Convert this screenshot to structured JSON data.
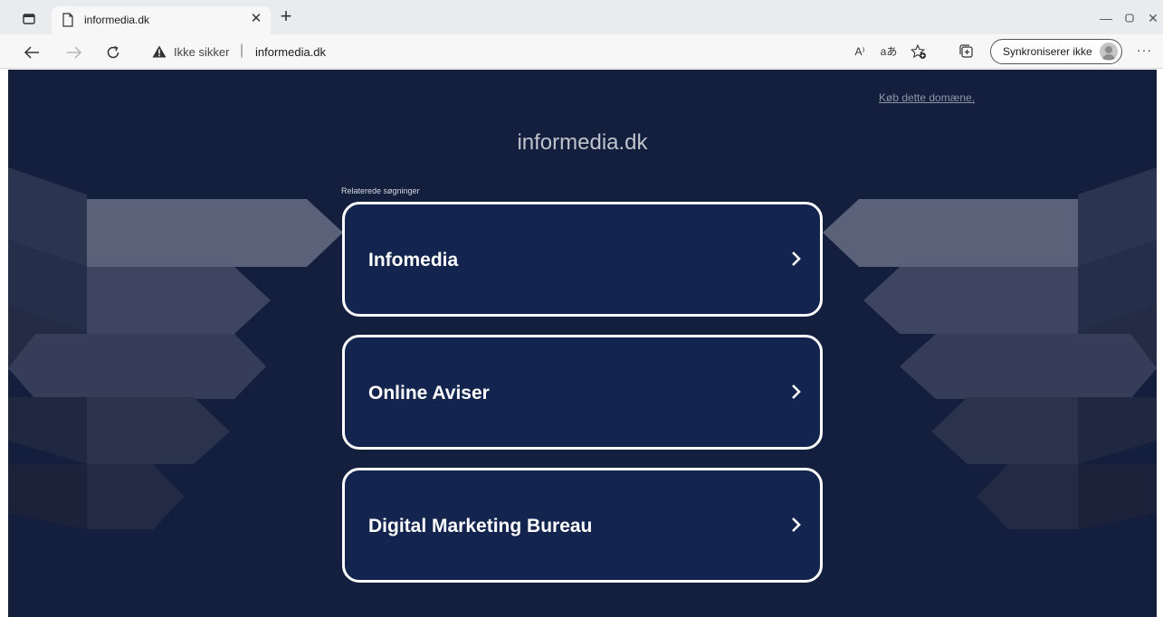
{
  "browser": {
    "tab_title": "informedia.dk",
    "security_label": "Ikke sikker",
    "url": "informedia.dk",
    "sync_label": "Synkroniserer ikke",
    "read_aloud_glyph": "A⁾",
    "translate_glyph": "aあ"
  },
  "page": {
    "buy_domain_link": "Køb dette domæne.",
    "site_title": "informedia.dk",
    "related_label": "Relaterede søgninger",
    "results": [
      {
        "label": "Infomedia"
      },
      {
        "label": "Online Aviser"
      },
      {
        "label": "Digital Marketing Bureau"
      }
    ]
  },
  "colors": {
    "page_background": "#141f3d",
    "card_background": "#13254f",
    "card_border": "#ffffff"
  }
}
